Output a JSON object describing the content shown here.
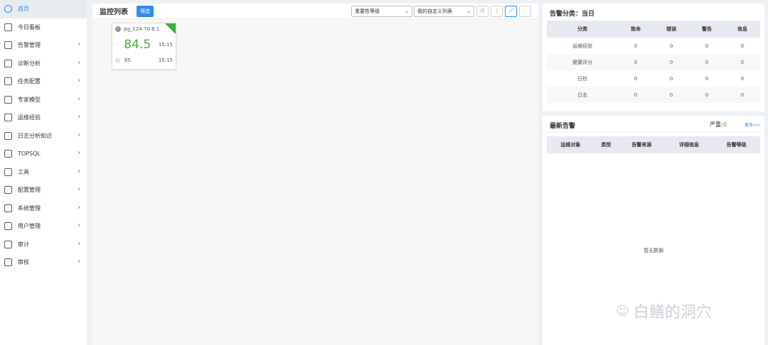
{
  "sidebar": {
    "items": [
      {
        "label": "首页",
        "icon": "cube-icon",
        "active": true
      },
      {
        "label": "今日看板",
        "icon": "monitor-icon"
      },
      {
        "label": "告警管理",
        "icon": "alarm-icon",
        "chevron": true
      },
      {
        "label": "诊断分析",
        "icon": "stethoscope-icon",
        "chevron": true
      },
      {
        "label": "任务配置",
        "icon": "task-icon",
        "chevron": true
      },
      {
        "label": "专家模型",
        "icon": "expert-icon",
        "chevron": true
      },
      {
        "label": "运维经验",
        "icon": "briefcase-icon",
        "chevron": true
      },
      {
        "label": "日志分析知识",
        "icon": "book-icon",
        "chevron": true
      },
      {
        "label": "TOPSQL",
        "icon": "database-icon",
        "chevron": true
      },
      {
        "label": "工具",
        "icon": "tools-icon",
        "chevron": true
      },
      {
        "label": "配置管理",
        "icon": "sliders-icon",
        "chevron": true
      },
      {
        "label": "系统管理",
        "icon": "gear-icon",
        "chevron": true
      },
      {
        "label": "用户管理",
        "icon": "user-icon",
        "chevron": true
      },
      {
        "label": "审计",
        "icon": "list-icon",
        "chevron": true
      },
      {
        "label": "审核",
        "icon": "clipboard-icon",
        "chevron": true
      }
    ]
  },
  "main": {
    "title": "监控列表",
    "filter_label": "筛选",
    "select1": "重要性等级",
    "select2": "我的自定义列表",
    "card": {
      "name": "pg_124.70.8.1",
      "score": "84.5",
      "score_time": "15:15",
      "value": "95",
      "value_time": "15:15",
      "score_color": "#3cb13c"
    }
  },
  "alarm_summary": {
    "title": "告警分类：当日",
    "headers": [
      "分类",
      "致命",
      "错误",
      "警告",
      "信息"
    ],
    "rows": [
      [
        "运维经验",
        "0",
        "0",
        "0",
        "0"
      ],
      [
        "健康评分",
        "0",
        "0",
        "0",
        "0"
      ],
      [
        "日检",
        "0",
        "0",
        "0",
        "0"
      ],
      [
        "日志",
        "0",
        "0",
        "0",
        "0"
      ]
    ]
  },
  "latest": {
    "title": "最新告警",
    "severe_label": "严重:",
    "severe_count": "0",
    "more": "更多>>",
    "headers": [
      "运维对象",
      "类型",
      "告警来源",
      "详细信息",
      "告警等级"
    ],
    "empty": "暂无数据"
  },
  "watermark": "白鳝的洞穴"
}
